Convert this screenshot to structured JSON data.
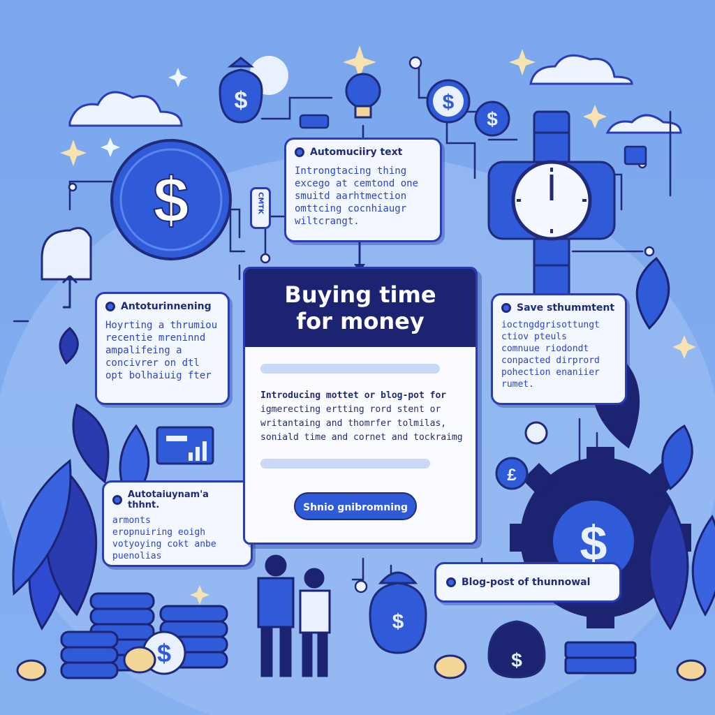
{
  "colors": {
    "background": "#7aa6ec",
    "navy": "#1c2371",
    "primary": "#2f5ad8",
    "card": "#f3f7ff",
    "accent_gold": "#f2d597"
  },
  "main_panel": {
    "title": "Buying time\nfor money",
    "lines": [
      "Introducing mottet or blog-pot for",
      "igmerecting ertting rord stent or",
      "writantaing and thomrfer tolmilas,",
      "soniald time and cornet and tockraimg"
    ],
    "button_label": "Shnio gnibromning"
  },
  "card_top": {
    "title": "Automuciiry text",
    "lines": [
      "Introngtacing thing",
      "excego at cemtond one",
      "smuitd aarhtmection",
      "omttcing cocnhiaugr",
      "wiltcrangt."
    ]
  },
  "card_left": {
    "title": "Antoturinnening",
    "lines": [
      "Hoyrting a thrumiou",
      "recentie mreninnd",
      "ampalifeing a",
      "concivrer on dtl",
      "opt bolhaiuig fter"
    ]
  },
  "card_right": {
    "title": "Save sthummtent",
    "lines": [
      "ioctngdgrisottungt",
      "ctiov pteuls",
      "comnuue riodondt",
      "conpacted dirprord",
      "pohection enaniier",
      "rumet."
    ]
  },
  "card_bottom_left": {
    "title": "Autotaiuynam'a thhnt.",
    "lines": [
      "armonts",
      "eropnuiring eoigh",
      "votyoying cokt anbe",
      "puenolias"
    ]
  },
  "card_bottom_right": {
    "title": "Blog-post of thunnowal"
  },
  "side_tag": {
    "label": "CMTK"
  },
  "icons": [
    "dollar-coin-icon",
    "money-bag-icon",
    "lightbulb-icon",
    "wristwatch-icon",
    "gear-icon",
    "coin-stack-icon",
    "people-illustration",
    "sparkle-icon",
    "cloud-icon",
    "leaf-plant-icon",
    "mini-chart-icon"
  ]
}
